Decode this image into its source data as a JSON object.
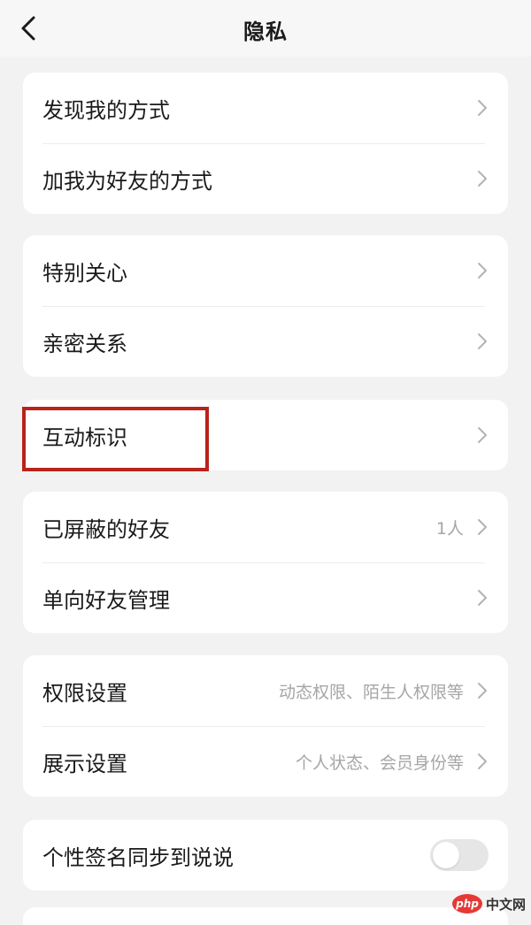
{
  "header": {
    "title": "隐私",
    "back_icon": "chevron-left-icon"
  },
  "groups": [
    {
      "items": [
        {
          "label": "发现我的方式",
          "value": ""
        },
        {
          "label": "加我为好友的方式",
          "value": ""
        }
      ]
    },
    {
      "items": [
        {
          "label": "特别关心",
          "value": ""
        },
        {
          "label": "亲密关系",
          "value": ""
        }
      ]
    },
    {
      "items": [
        {
          "label": "互动标识",
          "value": ""
        }
      ]
    },
    {
      "items": [
        {
          "label": "已屏蔽的好友",
          "value": "1人"
        },
        {
          "label": "单向好友管理",
          "value": ""
        }
      ]
    },
    {
      "items": [
        {
          "label": "权限设置",
          "value": "动态权限、陌生人权限等"
        },
        {
          "label": "展示设置",
          "value": "个人状态、会员身份等"
        }
      ]
    },
    {
      "items": [
        {
          "label": "个性签名同步到说说",
          "toggle": false
        }
      ]
    }
  ],
  "watermark": {
    "logo": "php",
    "text": "中文网"
  },
  "colors": {
    "background": "#f2f2f2",
    "card": "#ffffff",
    "highlight": "#b8231b",
    "secondary_text": "#a6a6a6"
  }
}
